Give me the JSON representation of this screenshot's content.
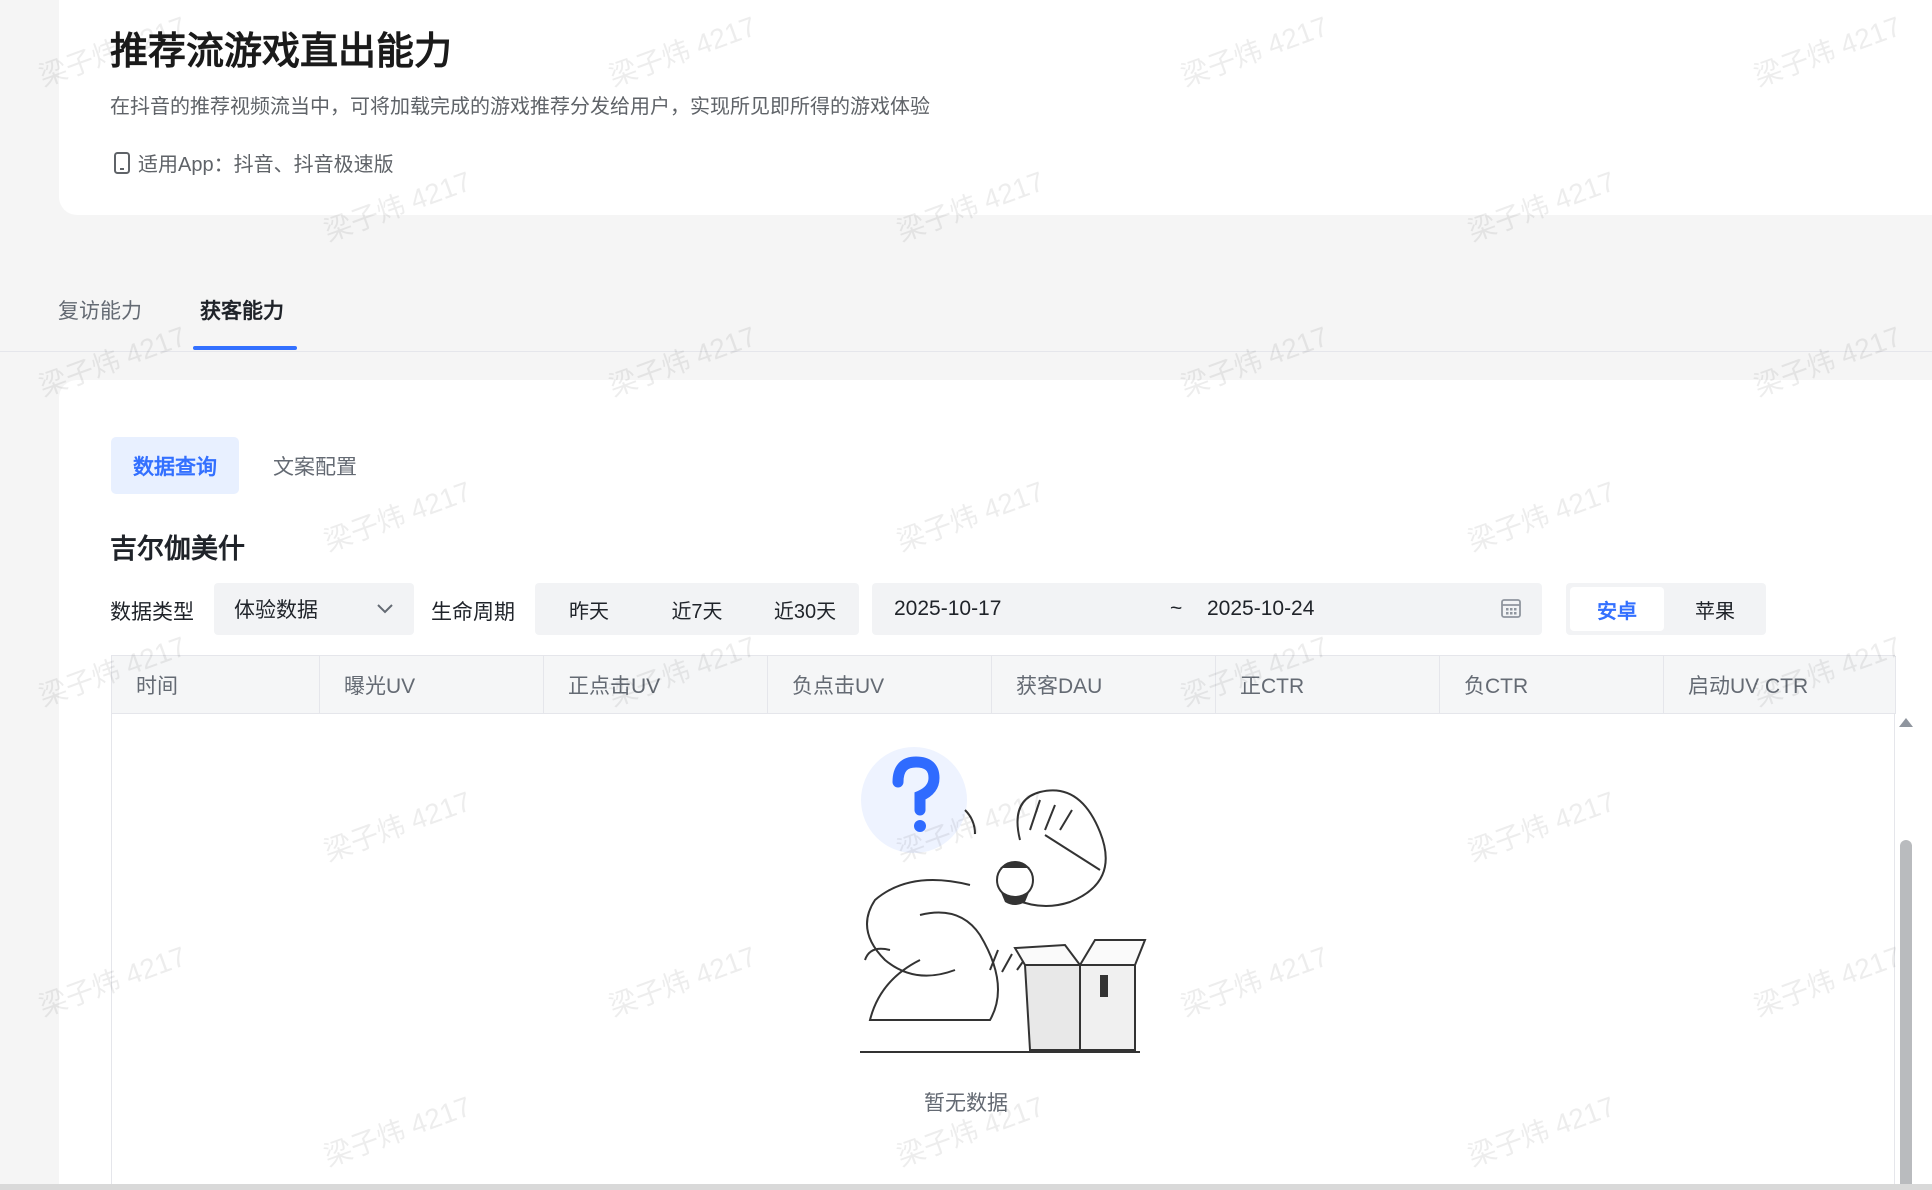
{
  "header": {
    "title": "推荐流游戏直出能力",
    "description": "在抖音的推荐视频流当中，可将加载完成的游戏推荐分发给用户，实现所见即所得的游戏体验",
    "apps_text": "适用App：抖音、抖音极速版"
  },
  "main_tabs": [
    {
      "label": "复访能力",
      "active": false
    },
    {
      "label": "获客能力",
      "active": true
    }
  ],
  "sub_tabs": [
    {
      "label": "数据查询",
      "active": true
    },
    {
      "label": "文案配置",
      "active": false
    }
  ],
  "game_name": "吉尔伽美什",
  "filters": {
    "data_type_label": "数据类型",
    "data_type_value": "体验数据",
    "lifecycle_label": "生命周期",
    "ranges": [
      "昨天",
      "近7天",
      "近30天"
    ],
    "date_start": "2025-10-17",
    "date_separator": "~",
    "date_end": "2025-10-24",
    "platforms": [
      {
        "label": "安卓",
        "active": true
      },
      {
        "label": "苹果",
        "active": false
      }
    ]
  },
  "table": {
    "columns": [
      "时间",
      "曝光UV",
      "正点击UV",
      "负点击UV",
      "获客DAU",
      "正CTR",
      "负CTR",
      "启动UV CTR"
    ],
    "rows": [],
    "empty_text": "暂无数据"
  },
  "watermark": "梁子炜 4217",
  "colors": {
    "accent": "#3370ff",
    "accent_bg": "#e8f0ff",
    "text_primary": "#1f2329",
    "text_secondary": "#646a73",
    "panel_bg": "#f2f3f5",
    "page_bg": "#f5f5f5"
  }
}
